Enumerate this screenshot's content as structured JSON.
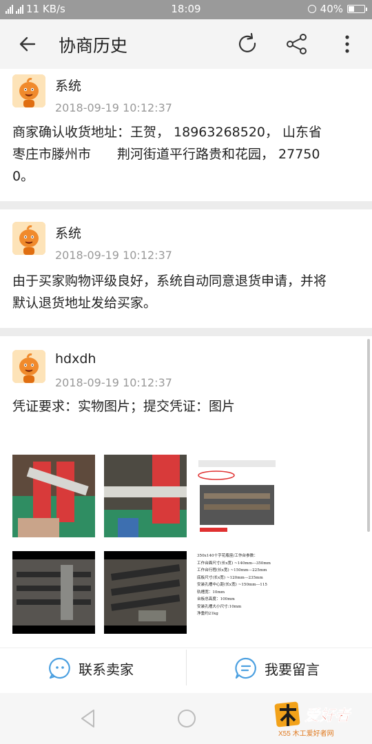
{
  "status_bar": {
    "network": "11 KB/s",
    "clock": "18:09",
    "battery": "40%",
    "battery_level": 0.4
  },
  "app_bar": {
    "title": "协商历史",
    "icons": [
      "back-arrow-icon",
      "refresh-icon",
      "share-icon",
      "more-vertical-icon"
    ]
  },
  "messages": [
    {
      "sender": "系统",
      "time": "2018-09-19 10:12:37",
      "lines": [
        "商家确认收货地址：王贺， 18963268520， 山东省",
        "枣庄市滕州市　　荆河街道平行路贵和花园， 27750",
        "0。"
      ]
    },
    {
      "sender": "系统",
      "time": "2018-09-19 10:12:37",
      "lines": [
        "由于买家购物评级良好，系统自动同意退货申请，并将",
        "默认退货地址发给买家。"
      ]
    },
    {
      "sender": "hdxdh",
      "time": "2018-09-19 10:12:37",
      "lines": [
        "凭证要求：实物图片；提交凭证：图片"
      ],
      "spec_sheet": [
        "350x140十字花瓶座/工作台参数：",
        "工作台面尺寸(长x宽) ~140mm---350mm",
        "工作台行程(长x宽) ~150mm---225mm",
        "底板尺寸(长x宽) ~120mm---235mm",
        "安装孔槽中心距(长x宽) ~150mm---115",
        "轨槽宽：10mm",
        "台板总高度：100mm",
        "安装孔槽大小尺寸:10mm",
        "净重约21kg"
      ]
    }
  ],
  "actions": {
    "contact_seller": "联系卖家",
    "leave_message": "我要留言"
  },
  "watermark": {
    "brand": "爱好者",
    "url": "X55 木工爱好者网"
  },
  "colors": {
    "accent_blue": "#4a9fe0",
    "avatar_orange": "#f08a2c",
    "status_bar": "#9a9a9a"
  }
}
